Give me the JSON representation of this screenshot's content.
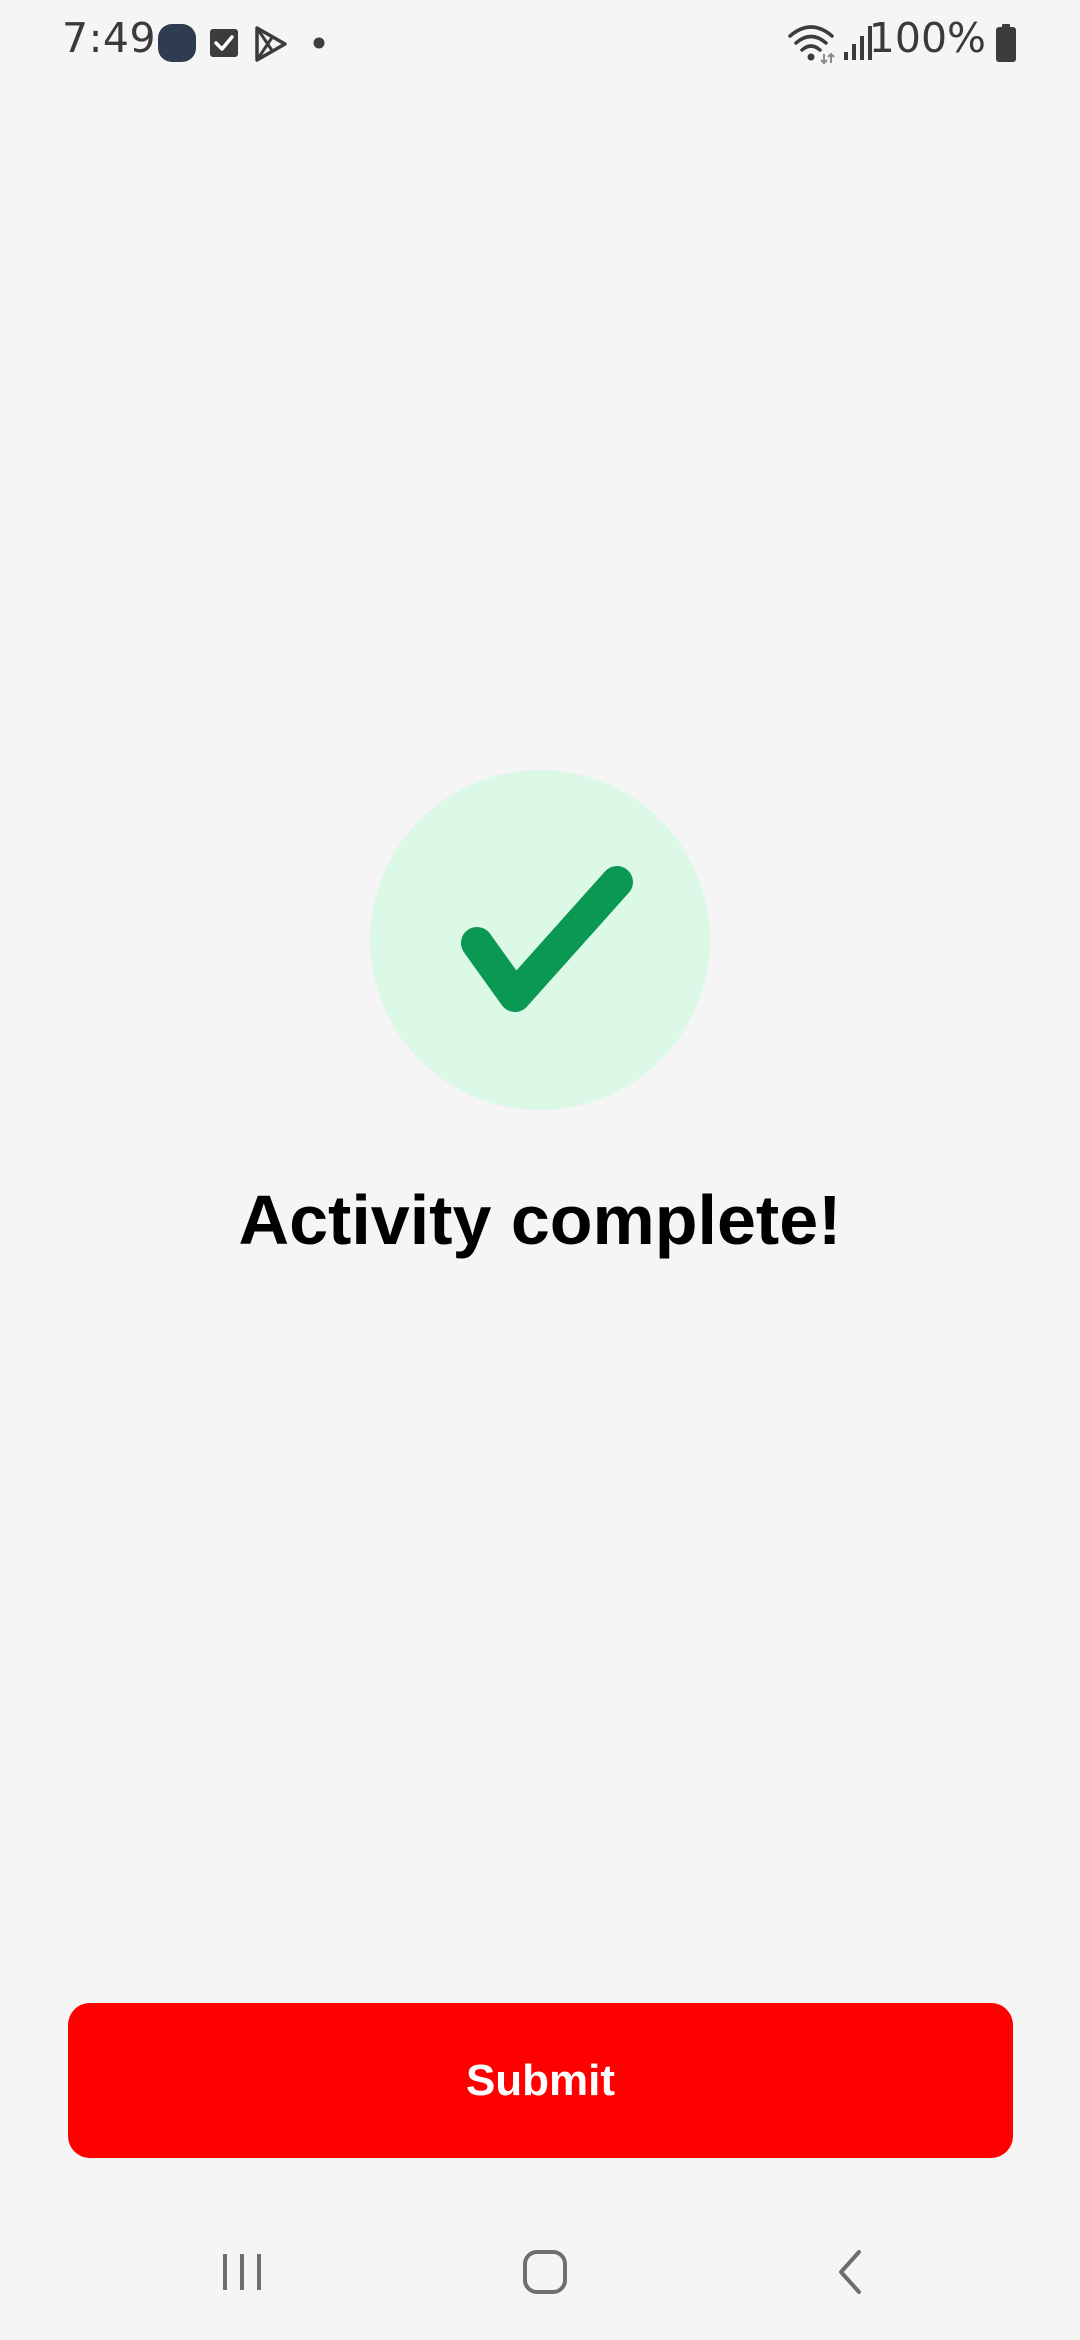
{
  "status_bar": {
    "time": "7:49",
    "battery_percent": "100%",
    "notification_icons": [
      "app-icon",
      "checkbox-icon",
      "play-store-icon",
      "dot-icon"
    ],
    "system_icons": [
      "wifi-icon",
      "signal-icon",
      "battery-icon"
    ]
  },
  "main": {
    "headline": "Activity complete!",
    "badge_icon": "checkmark-icon",
    "badge_bg_color": "#dcf8e6",
    "checkmark_color": "#0b9853"
  },
  "actions": {
    "submit_label": "Submit",
    "submit_color": "#ff0000"
  },
  "nav_bar": {
    "buttons": [
      "recents-icon",
      "home-icon",
      "back-icon"
    ]
  }
}
